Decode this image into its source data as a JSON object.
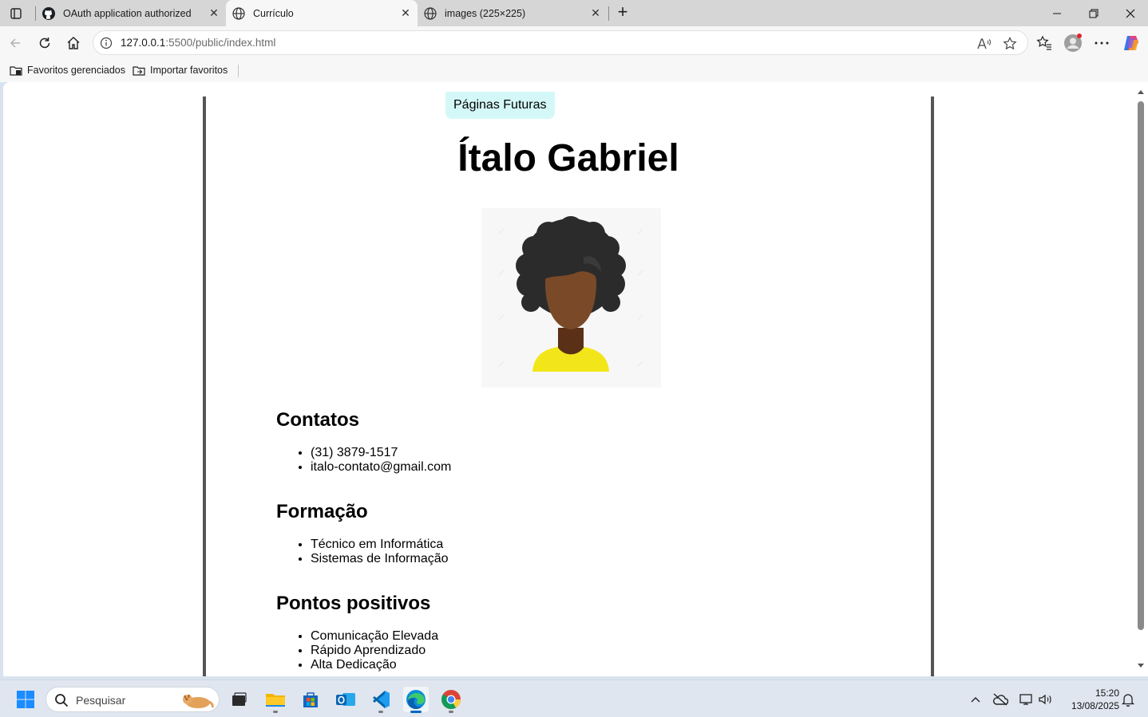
{
  "browser": {
    "tabs": [
      {
        "title": "OAuth application authorized",
        "icon": "github-icon",
        "active": false
      },
      {
        "title": "Currículo",
        "icon": "globe-icon",
        "active": true
      },
      {
        "title": "images (225×225)",
        "icon": "globe-icon",
        "active": false
      }
    ],
    "address": {
      "host": "127.0.0.1",
      "path": ":5500/public/index.html"
    },
    "favorites": [
      {
        "label": "Favoritos gerenciados",
        "icon": "managed-favorites-icon"
      },
      {
        "label": "Importar favoritos",
        "icon": "import-favorites-icon"
      }
    ]
  },
  "page": {
    "nav_link": "Páginas Futuras",
    "title": "Ítalo Gabriel",
    "avatar_icon": "profile-avatar-illustration",
    "sections": [
      {
        "heading": "Contatos",
        "items": [
          "(31) 3879-1517",
          "italo-contato@gmail.com"
        ]
      },
      {
        "heading": "Formação",
        "items": [
          "Técnico em Informática",
          "Sistemas de Informação"
        ]
      },
      {
        "heading": "Pontos positivos",
        "items": [
          "Comunicação Elevada",
          "Rápido Aprendizado",
          "Alta Dedicação"
        ]
      }
    ]
  },
  "taskbar": {
    "search_placeholder": "Pesquisar",
    "time": "15:20",
    "date": "13/08/2025"
  },
  "colors": {
    "nav_pill": "#d4f8f8",
    "page_border": "#555555",
    "avatar_shirt": "#f2e61a",
    "avatar_skin": "#7a4a28"
  }
}
